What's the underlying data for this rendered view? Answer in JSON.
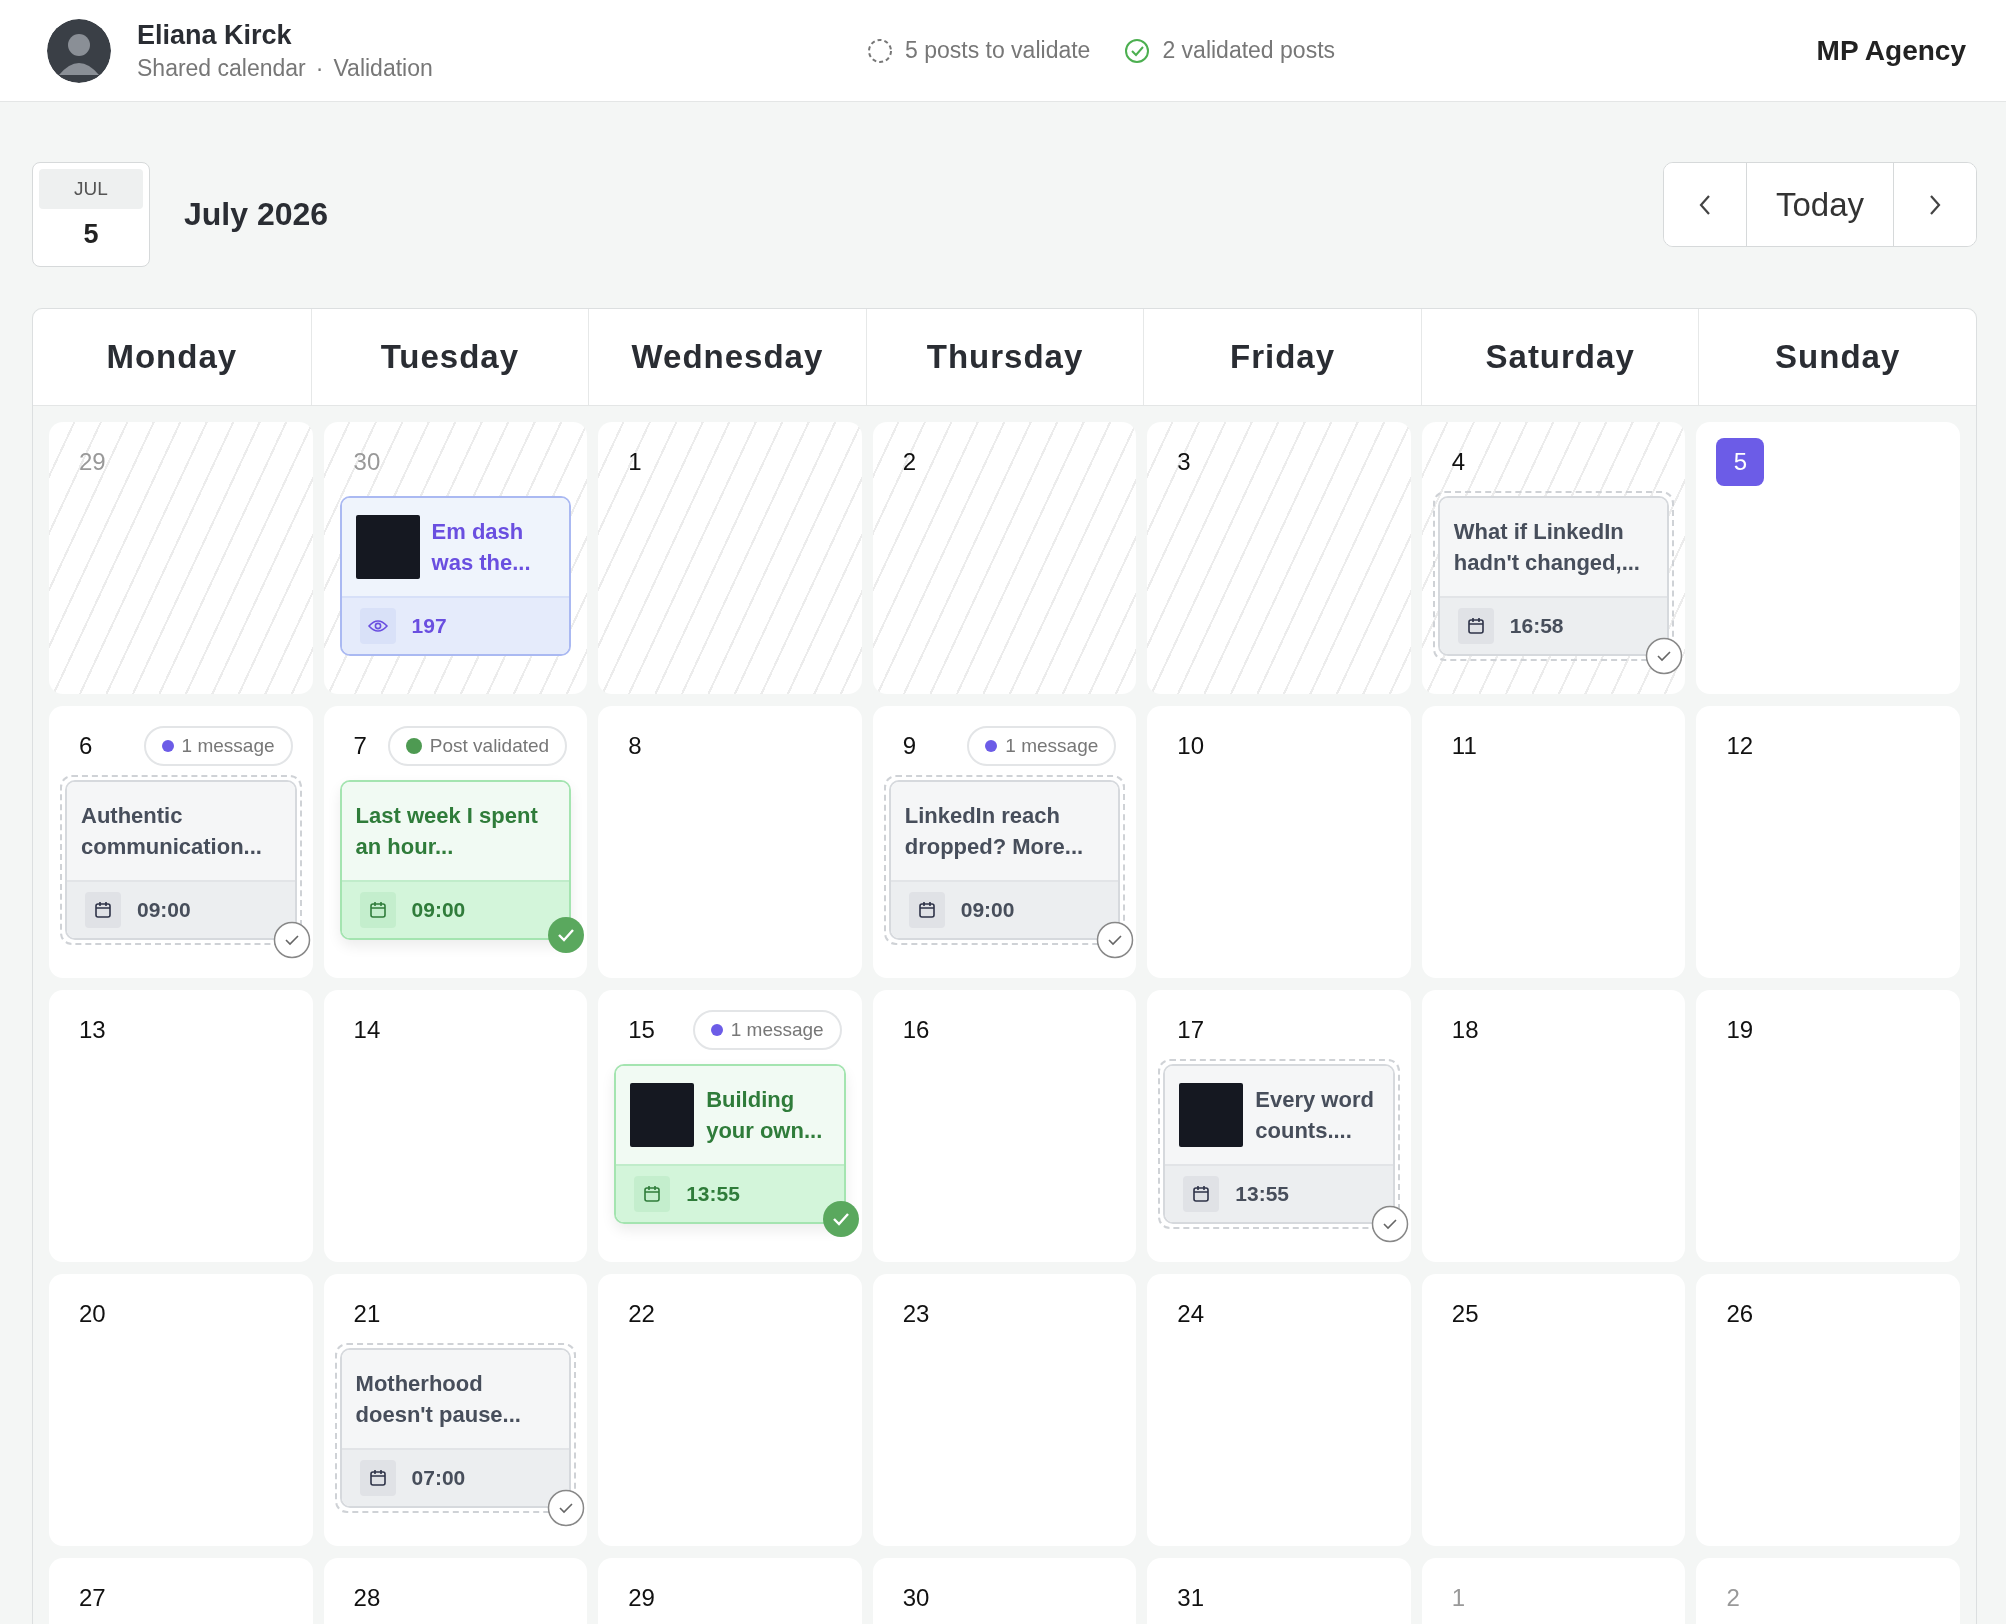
{
  "user": {
    "name": "Eliana Kirck",
    "context": "Shared calendar",
    "separator": "·",
    "section": "Validation"
  },
  "stats": [
    {
      "kind": "pending",
      "label": "5 posts to validate"
    },
    {
      "kind": "validated",
      "label": "2 validated posts"
    }
  ],
  "agency": "MP Agency",
  "date_badge": {
    "month": "JUL",
    "day": "5"
  },
  "title": "July 2026",
  "nav": {
    "today": "Today"
  },
  "weekdays": [
    "Monday",
    "Tuesday",
    "Wednesday",
    "Thursday",
    "Friday",
    "Saturday",
    "Sunday"
  ],
  "weeks": [
    [
      {
        "day": "29",
        "hatched": true,
        "other_month": true,
        "today": false
      },
      {
        "day": "30",
        "hatched": true,
        "other_month": true,
        "today": false,
        "post": {
          "kind": "published",
          "thumbnail": true,
          "title": "Em dash was the...",
          "meta": "197"
        }
      },
      {
        "day": "1",
        "hatched": true,
        "other_month": false,
        "today": false
      },
      {
        "day": "2",
        "hatched": true,
        "other_month": false,
        "today": false
      },
      {
        "day": "3",
        "hatched": true,
        "other_month": false,
        "today": false
      },
      {
        "day": "4",
        "hatched": true,
        "other_month": false,
        "today": false,
        "post": {
          "kind": "pending",
          "thumbnail": false,
          "title": "What if LinkedIn hadn't changed,...",
          "meta": "16:58"
        }
      },
      {
        "day": "5",
        "hatched": false,
        "today": true
      }
    ],
    [
      {
        "day": "6",
        "hatched": false,
        "other_month": false,
        "today": false,
        "badge": {
          "kind": "message",
          "label": "1 message"
        },
        "post": {
          "kind": "pending",
          "thumbnail": false,
          "title": "Authentic communication...",
          "meta": "09:00"
        }
      },
      {
        "day": "7",
        "hatched": false,
        "other_month": false,
        "today": false,
        "badge": {
          "kind": "validated",
          "label": "Post validated"
        },
        "post": {
          "kind": "validated",
          "thumbnail": false,
          "title": "Last week I spent an hour...",
          "meta": "09:00"
        }
      },
      {
        "day": "8",
        "hatched": false,
        "other_month": false,
        "today": false
      },
      {
        "day": "9",
        "hatched": false,
        "other_month": false,
        "today": false,
        "badge": {
          "kind": "message",
          "label": "1 message"
        },
        "post": {
          "kind": "pending",
          "thumbnail": false,
          "title": "LinkedIn reach dropped? More...",
          "meta": "09:00"
        }
      },
      {
        "day": "10",
        "hatched": false,
        "other_month": false,
        "today": false
      },
      {
        "day": "11",
        "hatched": false,
        "other_month": false,
        "today": false
      },
      {
        "day": "12",
        "hatched": false,
        "other_month": false,
        "today": false
      }
    ],
    [
      {
        "day": "13",
        "hatched": false,
        "other_month": false,
        "today": false
      },
      {
        "day": "14",
        "hatched": false,
        "other_month": false,
        "today": false
      },
      {
        "day": "15",
        "hatched": false,
        "other_month": false,
        "today": false,
        "badge": {
          "kind": "message",
          "label": "1 message"
        },
        "post": {
          "kind": "validated",
          "thumbnail": true,
          "title": "Building your own...",
          "meta": "13:55"
        }
      },
      {
        "day": "16",
        "hatched": false,
        "other_month": false,
        "today": false
      },
      {
        "day": "17",
        "hatched": false,
        "other_month": false,
        "today": false,
        "post": {
          "kind": "pending",
          "thumbnail": true,
          "title": "Every word counts....",
          "meta": "13:55"
        }
      },
      {
        "day": "18",
        "hatched": false,
        "other_month": false,
        "today": false
      },
      {
        "day": "19",
        "hatched": false,
        "other_month": false,
        "today": false
      }
    ],
    [
      {
        "day": "20",
        "hatched": false,
        "other_month": false,
        "today": false
      },
      {
        "day": "21",
        "hatched": false,
        "other_month": false,
        "today": false,
        "post": {
          "kind": "pending",
          "thumbnail": false,
          "title": "Motherhood doesn't pause...",
          "meta": "07:00"
        }
      },
      {
        "day": "22",
        "hatched": false,
        "other_month": false,
        "today": false
      },
      {
        "day": "23",
        "hatched": false,
        "other_month": false,
        "today": false
      },
      {
        "day": "24",
        "hatched": false,
        "other_month": false,
        "today": false
      },
      {
        "day": "25",
        "hatched": false,
        "other_month": false,
        "today": false
      },
      {
        "day": "26",
        "hatched": false,
        "other_month": false,
        "today": false
      }
    ],
    [
      {
        "day": "27",
        "hatched": false,
        "other_month": false,
        "today": false
      },
      {
        "day": "28",
        "hatched": false,
        "other_month": false,
        "today": false
      },
      {
        "day": "29",
        "hatched": false,
        "other_month": false,
        "today": false
      },
      {
        "day": "30",
        "hatched": false,
        "other_month": false,
        "today": false
      },
      {
        "day": "31",
        "hatched": false,
        "other_month": false,
        "today": false
      },
      {
        "day": "1",
        "hatched": false,
        "other_month": true,
        "today": false
      },
      {
        "day": "2",
        "hatched": false,
        "other_month": true,
        "today": false
      }
    ]
  ]
}
